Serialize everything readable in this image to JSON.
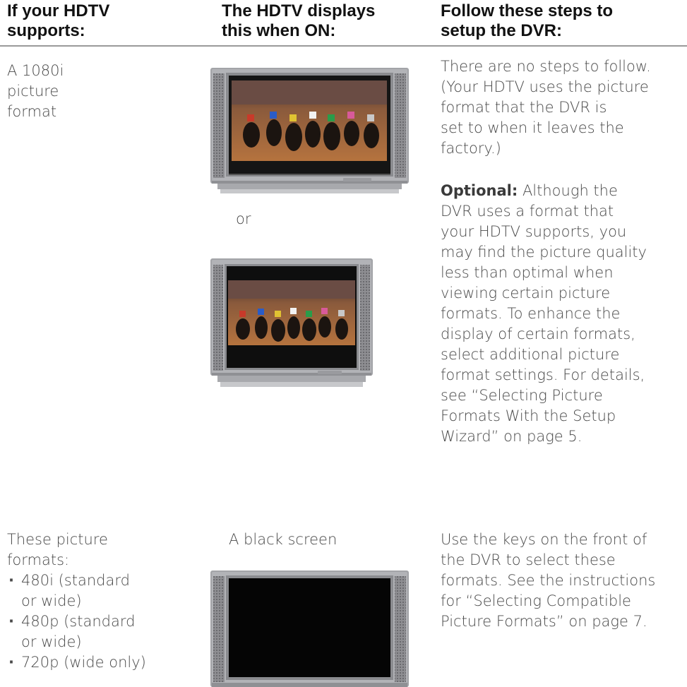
{
  "headers": {
    "col1": [
      "If your HDTV",
      "supports:"
    ],
    "col2": [
      "The HDTV displays",
      "this when ON:"
    ],
    "col3": [
      "Follow these steps to",
      "setup the DVR:"
    ]
  },
  "row1": {
    "supports": [
      "A 1080i",
      "picture",
      "format"
    ],
    "display_or": "or",
    "steps": [
      "There are no steps to follow.",
      "(Your HDTV uses the picture",
      "format that the DVR is",
      "set to when it leaves the",
      "factory.)"
    ],
    "optional_label": "Optional:",
    "optional_lines": [
      " Although the",
      "DVR uses a format that",
      "your HDTV supports, you",
      "may find the picture quality",
      "less than optimal when",
      "viewing certain picture",
      "formats. To enhance the",
      "display of certain formats,",
      "select additional picture",
      "format settings. For details,",
      "see “Selecting Picture",
      "Formats With the Setup",
      "Wizard” on page 5."
    ]
  },
  "row2": {
    "supports_intro": [
      "These picture",
      "formats:"
    ],
    "bullets": [
      "480i (standard or wide)",
      "480p (standard or wide)",
      "720p (wide only)"
    ],
    "display": "A black screen",
    "steps": [
      "Use the keys on the front of",
      "the DVR to select these",
      "formats. See the instructions",
      "for  “Selecting Compatible",
      "Picture Formats” on page 7."
    ]
  }
}
